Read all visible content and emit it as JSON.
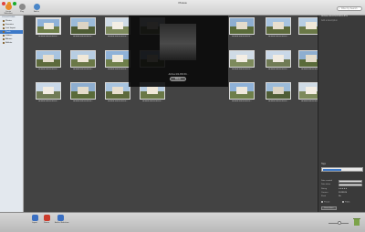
{
  "window": {
    "title": "Picasa"
  },
  "toolbar": {
    "buttons": [
      {
        "label": "Create Slideshow",
        "color": "#e88a2a",
        "icon": "slideshow-icon"
      },
      {
        "label": "Play",
        "color": "#8a8a8a",
        "icon": "play-icon"
      },
      {
        "label": "Add to",
        "color": "#4a86c8",
        "icon": "add-icon"
      }
    ],
    "search_placeholder": "Filter by Search"
  },
  "sidebar": {
    "header": "COLLECTIONS",
    "items": [
      {
        "label": "Photos",
        "selected": false
      },
      {
        "label": "Favorites",
        "selected": false
      },
      {
        "label": "Last Import",
        "selected": false
      },
      {
        "label": "Trash",
        "selected": true
      },
      {
        "label": "Folders",
        "selected": false
      },
      {
        "label": "Albums",
        "selected": false
      },
      {
        "label": "Bulletin",
        "selected": false
      }
    ]
  },
  "grid": {
    "captions": [
      "Ainhoa 102-DSCF0...",
      "Ainhoa 102-DSCF0...",
      "Ainhoa 102-DSCF0...",
      "",
      "Ainhoa 102-DSCF0...",
      "Ainhoa 102-DSCF0...",
      "",
      "Ainhoa 102-DSCF0...",
      "Ainhoa 102-DSCF0...",
      "Ainhoa 102-DSCF0...",
      "",
      "Ainhoa 102-DSCF0...",
      "Ainhoa 102-DSCF0...",
      "Ainhoa 102-DSCF0...",
      "Ainhoa 102-DSCF0...",
      "Ainhoa 102-DSCF0...",
      "Ainhoa 102-DSCF0...",
      "Ainhoa 102-DSCF0...",
      "Ainhoa 102-DSCF0...",
      "Ainhoa 102-DSCF0...",
      "Ainhoa 102-DSCF0..."
    ]
  },
  "overlay": {
    "caption": "Ainhoa 102-DSCF0...",
    "done_label": "Done"
  },
  "inspector": {
    "name": "Ainhoa 102-DSCF0001.JPG",
    "description_placeholder": "Add a description",
    "tags_label": "Tags",
    "rows": [
      {
        "label": "Date created",
        "value": ""
      },
      {
        "label": "Date taken",
        "value": ""
      },
      {
        "label": "Rating",
        "value": "★★★★★"
      },
      {
        "label": "Camera",
        "value": "FUJIFILM"
      },
      {
        "label": "Flash",
        "value": "No"
      }
    ],
    "checks": [
      "Private",
      "Public"
    ],
    "more_label": "Show More"
  },
  "bottombar": {
    "buttons": [
      {
        "label": "Import",
        "color": "#3a6fc2",
        "icon": "import-icon"
      },
      {
        "label": "Rotate",
        "color": "#cc3b2b",
        "icon": "rotate-icon"
      },
      {
        "label": "Add to Slideshow",
        "color": "#3a6fc2",
        "icon": "slideshow-icon"
      }
    ]
  }
}
